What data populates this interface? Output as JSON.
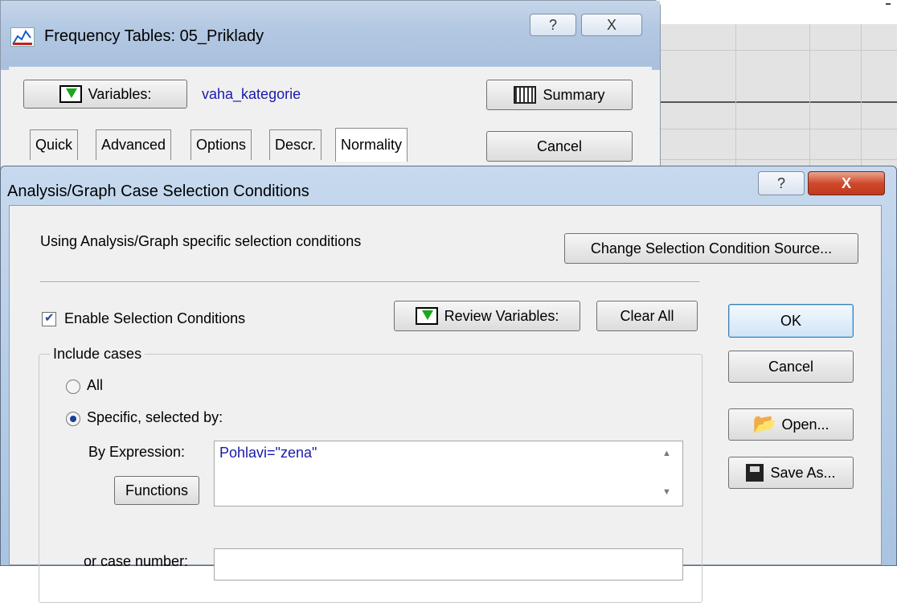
{
  "back_window": {
    "title": "Frequency Tables: 05_Priklady",
    "help_glyph": "?",
    "close_glyph": "X",
    "variables_button": "Variables:",
    "variables_value": "vaha_kategorie",
    "summary_button": "Summary",
    "cancel_button": "Cancel",
    "tabs": [
      "Quick",
      "Advanced",
      "Options",
      "Descr.",
      "Normality"
    ]
  },
  "dialog": {
    "title": "Analysis/Graph Case Selection Conditions",
    "help_glyph": "?",
    "close_glyph": "X",
    "info_text": "Using Analysis/Graph specific selection conditions",
    "change_source_button": "Change Selection Condition Source...",
    "enable_checkbox_label": "Enable Selection Conditions",
    "enable_checked": true,
    "review_variables_button": "Review Variables:",
    "clear_all_button": "Clear All",
    "ok_button": "OK",
    "cancel_button": "Cancel",
    "open_button": "Open...",
    "save_as_button": "Save As...",
    "include_cases_label": "Include cases",
    "radio_all_label": "All",
    "radio_specific_label": "Specific, selected by:",
    "selected_radio": "specific",
    "by_expression_label": "By Expression:",
    "expression_value": "Pohlavi=\"zena\"",
    "functions_button": "Functions",
    "case_number_label": "or case number:",
    "case_number_value": ""
  },
  "icons": {
    "back_title": "chart-icon",
    "variables": "variables-icon",
    "summary": "summary-table-icon",
    "review": "variables-icon",
    "open": "folder-open-icon",
    "save": "floppy-disk-icon"
  }
}
